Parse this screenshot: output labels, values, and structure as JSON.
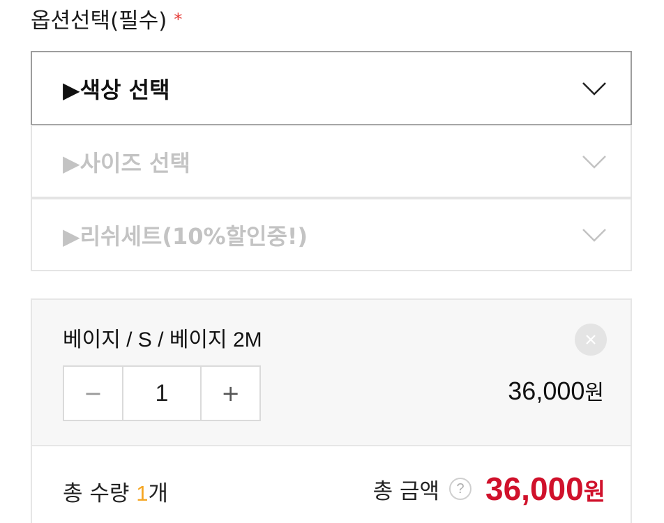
{
  "options": {
    "label": "옵션선택(필수)",
    "required_mark": "*",
    "selects": [
      {
        "text": "▶색상 선택",
        "state": "active"
      },
      {
        "text": "▶사이즈 선택",
        "state": "disabled"
      },
      {
        "text": "▶리쉬세트(10%할인중!)",
        "state": "disabled"
      }
    ]
  },
  "selected_item": {
    "name": "베이지 / S / 베이지 2M",
    "quantity": "1",
    "minus_symbol": "−",
    "plus_symbol": "+",
    "price": "36,000",
    "currency": "원"
  },
  "summary": {
    "qty_label": "총 수량 ",
    "qty_value": "1",
    "qty_unit": "개",
    "amount_label": "총 금액",
    "help_symbol": "?",
    "amount_value": "36,000",
    "currency": "원"
  },
  "colors": {
    "accent_red": "#d0112b",
    "qty_highlight": "#f5a623",
    "required_red": "#e53935"
  }
}
